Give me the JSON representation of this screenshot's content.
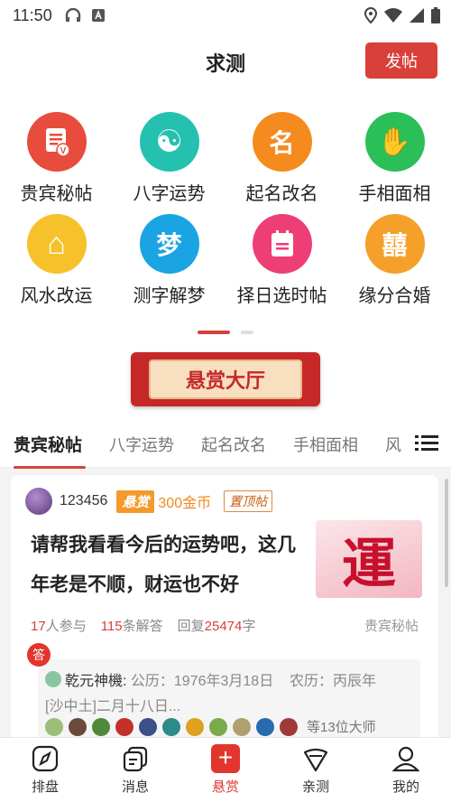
{
  "status_bar": {
    "time": "11:50"
  },
  "header": {
    "title": "求测",
    "post_button": "发帖"
  },
  "categories": [
    {
      "label": "贵宾秘帖",
      "glyph": "",
      "color": "#e74c3c",
      "icon": "vip-document-icon"
    },
    {
      "label": "八字运势",
      "glyph": "☯",
      "color": "#25c1b0",
      "icon": "yin-yang-icon"
    },
    {
      "label": "起名改名",
      "glyph": "名",
      "color": "#f58b1f",
      "icon": "name-icon"
    },
    {
      "label": "手相面相",
      "glyph": "✋",
      "color": "#2bbf58",
      "icon": "palm-icon"
    },
    {
      "label": "风水改运",
      "glyph": "⌂",
      "color": "#f6c12b",
      "icon": "house-icon"
    },
    {
      "label": "测字解梦",
      "glyph": "梦",
      "color": "#1aa4e3",
      "icon": "dream-icon"
    },
    {
      "label": "择日选时帖",
      "glyph": "",
      "color": "#ee3e76",
      "icon": "calendar-icon"
    },
    {
      "label": "缘分合婚",
      "glyph": "囍",
      "color": "#f5a02a",
      "icon": "double-happiness-icon"
    }
  ],
  "banner": {
    "label": "悬赏大厅"
  },
  "tabs": [
    "贵宾秘帖",
    "八字运势",
    "起名改名",
    "手相面相",
    "风"
  ],
  "post": {
    "username": "123456",
    "reward_badge": "悬赏",
    "reward_amount": "300金币",
    "pin_badge": "置顶帖",
    "title": "请帮我看看今后的运势吧，这几年老是不顺，财运也不好",
    "thumb_char": "運",
    "participants_num": "17",
    "participants_label": "人参与",
    "answers_num": "115",
    "answers_label": "条解答",
    "reply_prefix": "回复",
    "reply_num": "25474",
    "reply_suffix": "字",
    "category": "贵宾秘帖",
    "answer_tag": "答",
    "answer": {
      "master": "乾元神機:",
      "line1": " 公历：1976年3月18日    农历：丙辰年",
      "line2": "[沙中土]二月十八日..."
    },
    "masters_count": "等13位大师",
    "master_colors": [
      "#9bbf7a",
      "#6a4a3a",
      "#4f8a3a",
      "#c4302b",
      "#3b4f8a",
      "#2d8a8a",
      "#e0a020",
      "#7aaa4a",
      "#b0a070",
      "#2a6ab0",
      "#a03a3a"
    ]
  },
  "bottom_nav": [
    {
      "label": "排盘",
      "icon": "compass-icon"
    },
    {
      "label": "消息",
      "icon": "message-icon"
    },
    {
      "label": "悬赏",
      "icon": "reward-icon"
    },
    {
      "label": "亲测",
      "icon": "shield-icon"
    },
    {
      "label": "我的",
      "icon": "profile-icon"
    }
  ]
}
